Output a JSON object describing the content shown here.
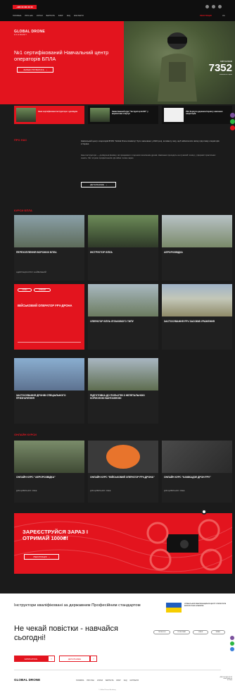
{
  "topbar": {
    "phone": "+380 00 000 00 00",
    "nav": [
      "ГОЛОВНА",
      "ПРО НАС",
      "КУРСИ",
      "ВАРТІСТЬ",
      "БЛОГ",
      "FAQ",
      "КОНТАКТИ"
    ],
    "register": "РЕЄСТРАЦІЯ",
    "lang": "UA"
  },
  "hero": {
    "logo": "GLOBAL DRONE",
    "logo_sub": "ACADEMY",
    "title": "№1 сертифікований Навчальний центр операторів БПЛА",
    "button": "ЗАРЕЄСТРУВАТИСЬ",
    "counter_label": "ВИПУСКНИКІВ",
    "counter_value": "7352",
    "counter_sub": "навчаються зараз"
  },
  "news": [
    {
      "title": "Наші сертифіковані інструктори з досвідом",
      "meta": ""
    },
    {
      "title": "Завантажений курс \"Інструктор БпЛА\" у вересні вже стартує",
      "meta": ""
    },
    {
      "title": "УКА Корпуси держмоніторингу навчання операторів",
      "meta": ""
    }
  ],
  "about": {
    "heading": "ПРО НАС",
    "p1": "Навчальний центр операторів БПЛА \"Global Drone Academy\" було засновано у 2022 році, як вимогу часу, щоб забезпечити якісну підготовку операторів в Україні.",
    "p2": "Наші інструктори — досвідчені фахівці, які працювали з першим поколінням дронів. Навчання проходить на сучасній техніці, у форматі практичних занять. Ми готуємо професіоналів. До війни та вже зараз.",
    "button": "ДЕТАЛЬНІШЕ"
  },
  "courses": {
    "heading": "КУРСИ БПЛА",
    "items": [
      {
        "title": "ПЕРЕХОПЛЕННЯ ВОРОЖИХ БПЛА",
        "meta": "АДАПТАЦІЯ КУРСУ: НАЙБІЛЬШИЙ"
      },
      {
        "title": "ІНСТРУКТОР БПЛА",
        "meta": ""
      },
      {
        "title": "АЕРОРОЗВІДКА",
        "meta": ""
      },
      {
        "title": "ВІЙСЬКОВИЙ ОПЕРАТОР FPV-ДРОНА",
        "meta": "",
        "tags": [
          "ОЧНО",
          "ОНЛАЙН"
        ]
      },
      {
        "title": "ОПЕРАТОР БПЛА ЛІТАКОВОГО ТИПУ",
        "meta": ""
      },
      {
        "title": "ЗАСТОСУВАННЯ FPV ЗАСОБІВ УРАЖЕННЯ",
        "meta": ""
      },
      {
        "title": "ЗАСТОСУВАННЯ ДРОНІВ СПЕЦІАЛЬНОГО ПРИЗНАЧЕННЯ",
        "meta": ""
      },
      {
        "title": "ПІДГОТОВКА ДО ПОЛЬОТІВ З НЕЛЕТАЛЬНОЮ КОРИСНОЮ ВАНТАЖНОЮ",
        "meta": ""
      }
    ]
  },
  "online": {
    "heading": "ОНЛАЙН КУРСИ",
    "items": [
      {
        "title": "ОНЛАЙН КУРС \"АЕРОРОЗВІДКА\"",
        "meta": "ДЛЯ ЦИВІЛЬНИХ: FREE"
      },
      {
        "title": "ОНЛАЙН КУРС \"ВІЙСЬКОВИЙ ОПЕРАТОР FPV-ДРОНА\"",
        "meta": "ДЛЯ ЦИВІЛЬНИХ: FREE"
      },
      {
        "title": "ОНЛАЙН КУРС \"КАМІКАДЗЕ ДРОН FPV\"",
        "meta": "ДЛЯ ЦИВІЛЬНИХ: FREE"
      }
    ]
  },
  "banner": {
    "title": "ЗАРЕЄСТРУЙСЯ ЗАРАЗ І ОТРИМАЙ 1000₴!",
    "button": "РЕЄСТРАЦІЯ"
  },
  "cert": {
    "title": "Інструктори кваліфіковані за державним Професійним стандартом",
    "agency": "УКРАЇНСЬКИЙ КВАЛІФІКАЦІЙНИЙ ЦЕНТР ОПЕРАТОРІВ БЕЗПІЛОТНИХ АПАРАТІВ"
  },
  "cta": {
    "title": "Не чекай повістки - навчайся сьогодні!",
    "primary": "ЗАПИСАТИСЬ",
    "secondary": "ДЕТАЛЬНІШЕ",
    "pills": [
      "ТЕЛЕФОН",
      "ТЕЛЕГРАМ",
      "VIBER",
      "EMAIL"
    ]
  },
  "footer": {
    "logo": "GLOBAL DRONE",
    "links": [
      "ГОЛОВНА",
      "ПРО НАС",
      "КУРСИ",
      "ВАРТІСТЬ",
      "БЛОГ",
      "FAQ",
      "КОНТАКТИ"
    ],
    "copyright": "© Global Drone Academy",
    "contacts": [
      "+380 00 000 00 00",
      "info@gda.ua",
      "м. Київ"
    ]
  },
  "colors": {
    "accent": "#e3141e",
    "bg": "#1b1b1b"
  }
}
